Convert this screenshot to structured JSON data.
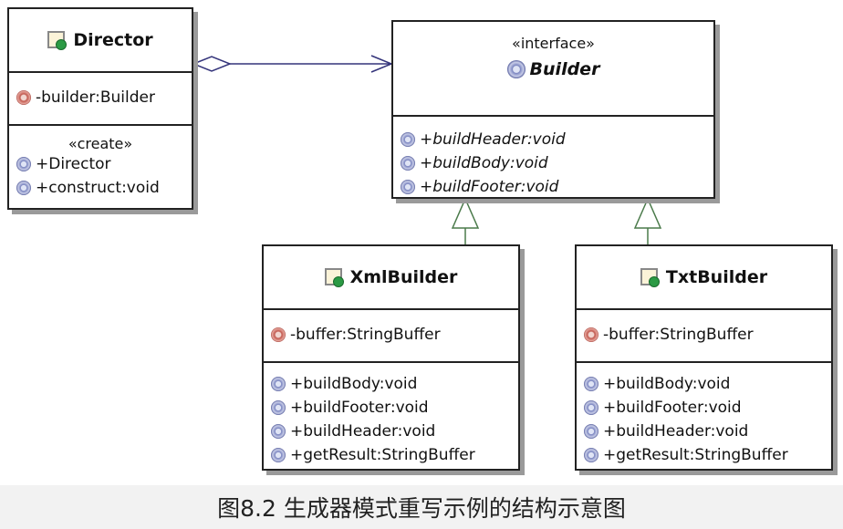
{
  "director": {
    "name": "Director",
    "attributes": [
      "-builder:Builder"
    ],
    "stereotype": "«create»",
    "operations": [
      "+Director",
      "+construct:void"
    ]
  },
  "builder": {
    "stereotype": "«interface»",
    "name": "Builder",
    "operations": [
      "+buildHeader:void",
      "+buildBody:void",
      "+buildFooter:void"
    ]
  },
  "xml_builder": {
    "name": "XmlBuilder",
    "attributes": [
      "-buffer:StringBuffer"
    ],
    "operations": [
      "+buildBody:void",
      "+buildFooter:void",
      "+buildHeader:void",
      "+getResult:StringBuffer"
    ]
  },
  "txt_builder": {
    "name": "TxtBuilder",
    "attributes": [
      "-buffer:StringBuffer"
    ],
    "operations": [
      "+buildBody:void",
      "+buildFooter:void",
      "+buildHeader:void",
      "+getResult:StringBuffer"
    ]
  },
  "caption": "图8.2  生成器模式重写示例的结构示意图",
  "colors": {
    "association": "#33337a",
    "generalization": "#4a7a4a",
    "class_icon": "#2b9a44"
  }
}
